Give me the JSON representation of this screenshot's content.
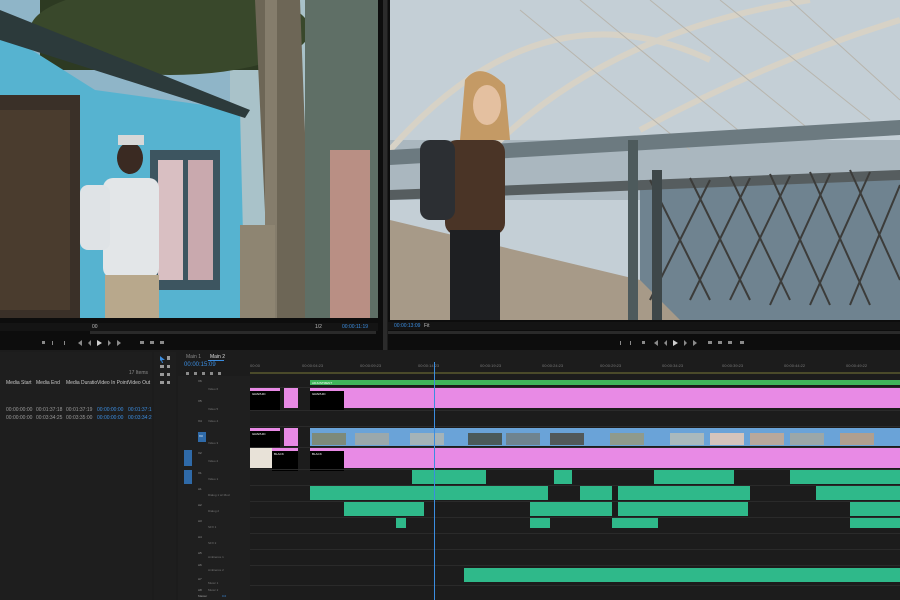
{
  "source_monitor": {
    "timecode_left": "00",
    "zoom": "1/2",
    "timecode_right": "00:00:11:19"
  },
  "program_monitor": {
    "timecode_left": "00:00:13:09",
    "fit": "Fit"
  },
  "project_panel": {
    "item_count": "17 Items",
    "columns": [
      "Media Start",
      "Media End",
      "Media Duratio",
      "Video In Point",
      "Video Out"
    ],
    "rows": [
      [
        "00:00:00:00",
        "00:01:37:18",
        "00:01:37:19",
        "00:00:00:00",
        "00:01:37:1"
      ],
      [
        "00:00:00:00",
        "00:03:34:25",
        "00:03:35:00",
        "00:00:00:00",
        "00:03:34:2"
      ]
    ]
  },
  "timeline": {
    "tabs": [
      "Main 1",
      "Main 2"
    ],
    "timecode": "00:00:15:09",
    "ruler": [
      "00:00",
      "00:00:04:23",
      "00:00:09:23",
      "00:00:14:23",
      "00:00:19:23",
      "00:00:24:23",
      "00:00:29:23",
      "00:00:34:23",
      "00:00:39:23",
      "00:00:44:22",
      "00:00:49:22"
    ],
    "tracks": [
      {
        "id": "V6",
        "name": "Video 6"
      },
      {
        "id": "V5",
        "name": "Video 5"
      },
      {
        "id": "V4",
        "name": "Video 4"
      },
      {
        "id": "V3",
        "name": "Video 3"
      },
      {
        "id": "V2",
        "name": "Video 2"
      },
      {
        "id": "V1",
        "name": "Video 1"
      },
      {
        "id": "A1",
        "name": "Dialog 1 w/ Mod"
      },
      {
        "id": "A2",
        "name": "Dialog 2"
      },
      {
        "id": "A3",
        "name": "SFX 1"
      },
      {
        "id": "A4",
        "name": "SFX 2"
      },
      {
        "id": "A5",
        "name": "Ambience 1"
      },
      {
        "id": "A6",
        "name": "Ambience 2"
      },
      {
        "id": "A7",
        "name": "Music 1"
      },
      {
        "id": "A8",
        "name": "Music 2"
      },
      {
        "id": "M",
        "name": "Master"
      }
    ],
    "master_value": "0.0",
    "clip_labels": {
      "adjustment": "ADJUSTMENT",
      "graphic1": "GRAPHIC",
      "graphic2": "GRAPHIC",
      "graphic3": "GRAPHIC",
      "black": "BLACK",
      "black2": "BLACK"
    },
    "colors": {
      "pink": "#e88ae5",
      "video_blue": "#6aa3d8",
      "audio_green": "#2fb98a",
      "adjust_green": "#3fb55a",
      "playhead": "#3b8de0"
    }
  }
}
